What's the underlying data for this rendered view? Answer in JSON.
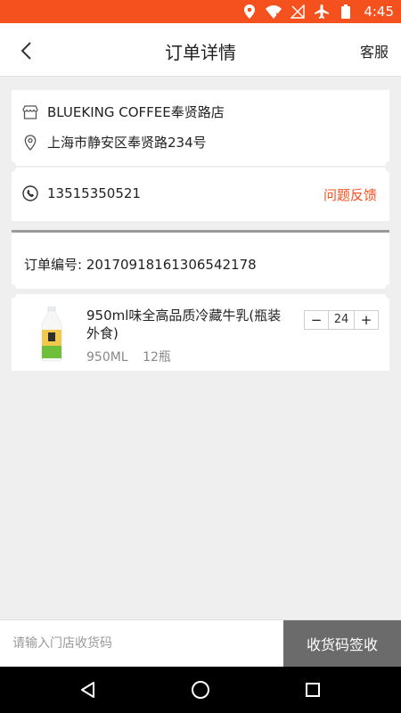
{
  "status_bar": {
    "time": "4:45",
    "background": "#f4511e",
    "icons": [
      "location-icon",
      "wifi-icon",
      "signal-off-icon",
      "airplane-icon",
      "battery-icon"
    ]
  },
  "header": {
    "title": "订单详情",
    "service_label": "客服",
    "back_icon": "chevron-left-icon"
  },
  "store": {
    "name": "BLUEKING COFFEE奉贤路店",
    "address": "上海市静安区奉贤路234号",
    "icons": [
      "store-icon",
      "location-pin-icon"
    ]
  },
  "contact": {
    "phone": "13515350521",
    "feedback_label": "问题反馈",
    "feedback_color": "#f4511e",
    "icon": "phone-icon"
  },
  "order": {
    "number_label": "订单编号: 2017091816130654217​8"
  },
  "product": {
    "name": "950ml味全高品质冷藏牛乳(瓶装外食)",
    "volume": "950ML",
    "count": "12瓶",
    "quantity": "24",
    "minus_label": "−",
    "plus_label": "+"
  },
  "receipt": {
    "placeholder": "请输入门店收货码",
    "submit_label": "收货码签收",
    "submit_color": "#6b6b6b"
  },
  "system_nav": {
    "icons": [
      "back-triangle-icon",
      "home-circle-icon",
      "recents-square-icon"
    ]
  }
}
